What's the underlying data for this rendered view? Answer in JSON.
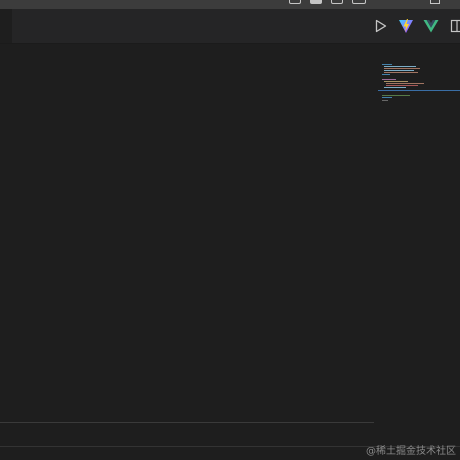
{
  "window": {
    "layout_controls": [
      "toggle-primary-sidebar",
      "toggle-panel",
      "toggle-secondary-sidebar",
      "customize-layout"
    ]
  },
  "editor_actions": {
    "run_icon": "play-icon",
    "vite_icon": "vite-icon",
    "vue_icon": "vue-icon",
    "split_icon": "split-editor-icon"
  },
  "colors": {
    "background": "#1e1e1e",
    "titlebar": "#3c3c3c",
    "tabbar": "#252526",
    "minimap_slider": "#3a6ea5"
  },
  "watermark": "@稀土掘金技术社区"
}
